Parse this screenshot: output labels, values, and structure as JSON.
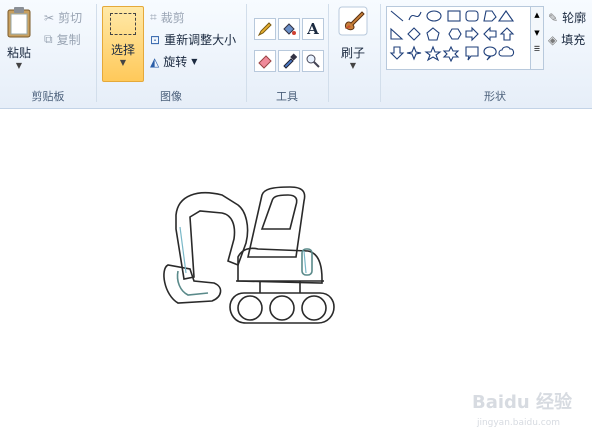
{
  "clipboard": {
    "paste_label": "粘贴",
    "cut_label": "剪切",
    "copy_label": "复制",
    "group_label": "剪贴板"
  },
  "image": {
    "select_label": "选择",
    "crop_label": "裁剪",
    "resize_label": "重新调整大小",
    "rotate_label": "旋转",
    "group_label": "图像"
  },
  "tools": {
    "group_label": "工具",
    "icons": [
      "pencil-icon",
      "fill-icon",
      "text-icon",
      "eraser-icon",
      "color-picker-icon",
      "magnifier-icon"
    ],
    "text_glyph": "A"
  },
  "brushes": {
    "label": "刷子"
  },
  "shapes": {
    "group_label": "形状",
    "outline_label": "轮廓",
    "fill_label": "填充"
  },
  "watermark": {
    "brand": "Baidu 经验",
    "url": "jingyan.baidu.com"
  },
  "colors": {
    "select_active": "#ffc95a",
    "ribbon_bg": "#e6eef8"
  }
}
